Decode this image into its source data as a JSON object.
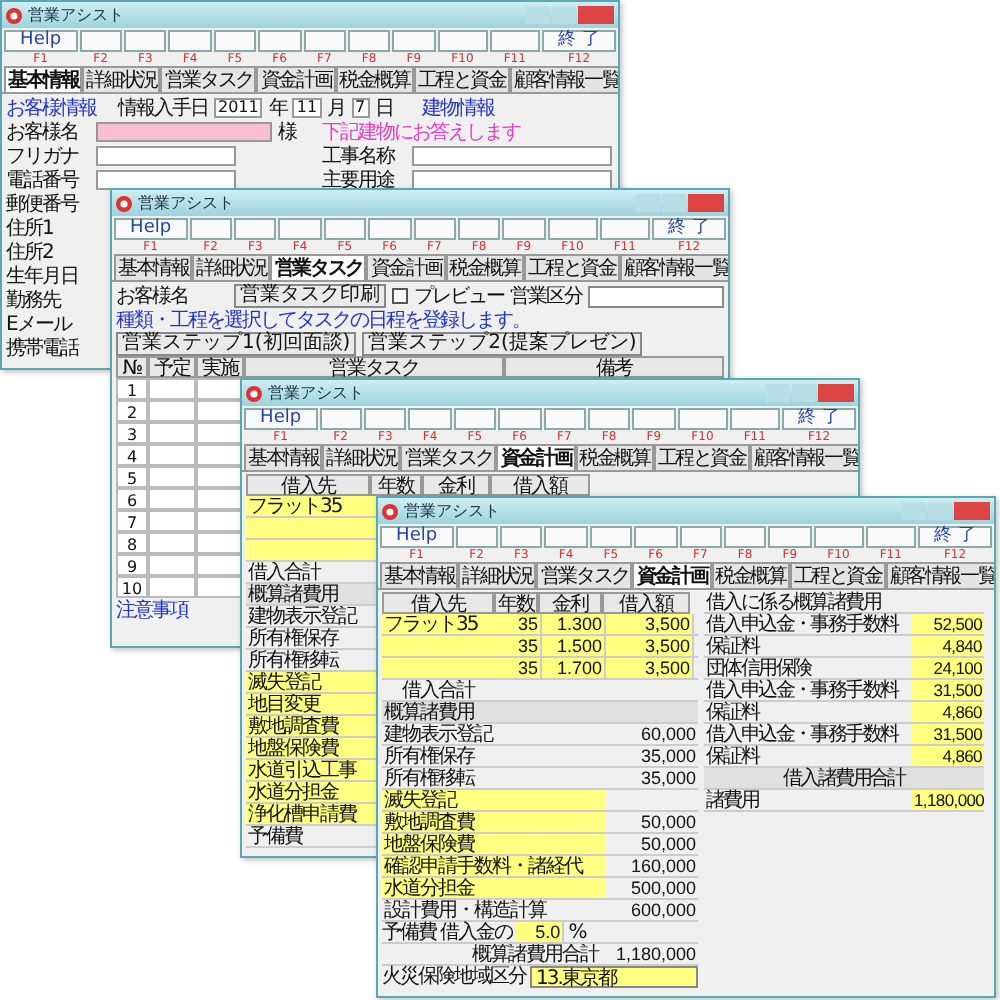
{
  "windows": [
    {
      "kind": "customer",
      "title": "営業アシスト",
      "toolbar": [
        {
          "key": "F1",
          "label": "Help"
        },
        {
          "key": "F2"
        },
        {
          "key": "F3"
        },
        {
          "key": "F4"
        },
        {
          "key": "F5"
        },
        {
          "key": "F6"
        },
        {
          "key": "F7"
        },
        {
          "key": "F8"
        },
        {
          "key": "F9"
        },
        {
          "key": "F10"
        },
        {
          "key": "F11"
        },
        {
          "key": "F12",
          "label": "終 了"
        }
      ],
      "tabs": [
        {
          "label": "基本情報",
          "selected": true
        },
        {
          "label": "詳細状況",
          "selected": false
        },
        {
          "label": "営業タスク",
          "selected": false
        },
        {
          "label": "資金計画",
          "selected": false
        },
        {
          "label": "税金概算",
          "selected": false
        },
        {
          "label": "工程と資金",
          "selected": false
        },
        {
          "label": "顧客情報一覧",
          "selected": false
        }
      ],
      "section": "お客様情報",
      "date_label": "情報入手日",
      "year": "2011",
      "year_unit": "年",
      "month": "11",
      "month_unit": "月",
      "day": "7",
      "day_unit": "日",
      "building": "建物情報",
      "fields": [
        {
          "kind": "name",
          "label": "お客様名",
          "suffix": "様"
        },
        {
          "kind": "field",
          "label": "フリガナ"
        },
        {
          "kind": "field",
          "label": "電話番号"
        },
        {
          "kind": "label",
          "label": "郵便番号"
        },
        {
          "kind": "label",
          "label": "住所1"
        },
        {
          "kind": "label",
          "label": "住所2"
        },
        {
          "kind": "label",
          "label": "生年月日"
        },
        {
          "kind": "label",
          "label": "勤務先"
        },
        {
          "kind": "label",
          "label": "Eメール"
        },
        {
          "kind": "label",
          "label": "携帯電話"
        }
      ],
      "right_fields": [
        {
          "kind": "note",
          "label": "下記建物にお答えします"
        },
        {
          "kind": "field",
          "label": "工事名称"
        },
        {
          "kind": "field",
          "label": "主要用途"
        }
      ]
    },
    {
      "kind": "tasks",
      "title": "営業アシスト",
      "toolbar": [
        {
          "key": "F1",
          "label": "Help"
        },
        {
          "key": "F2"
        },
        {
          "key": "F3"
        },
        {
          "key": "F4"
        },
        {
          "key": "F5"
        },
        {
          "key": "F6"
        },
        {
          "key": "F7"
        },
        {
          "key": "F8"
        },
        {
          "key": "F9"
        },
        {
          "key": "F10"
        },
        {
          "key": "F11"
        },
        {
          "key": "F12",
          "label": "終 了"
        }
      ],
      "tabs": [
        {
          "label": "基本情報",
          "selected": false
        },
        {
          "label": "詳細状況",
          "selected": false
        },
        {
          "label": "営業タスク",
          "selected": true
        },
        {
          "label": "資金計画",
          "selected": false
        },
        {
          "label": "税金概算",
          "selected": false
        },
        {
          "label": "工程と資金",
          "selected": false
        },
        {
          "label": "顧客情報一覧",
          "selected": false
        }
      ],
      "customer_label": "お客様名",
      "print_button": "営業タスク印刷",
      "preview": {
        "label": "プレビュー",
        "checked": false
      },
      "category_label": "営業区分",
      "note": "種類・工程を選択してタスクの日程を登録します。",
      "steps": [
        "営業ステップ1(初回面談)",
        "営業ステップ2(提案プレゼン)"
      ],
      "columns": [
        "№",
        "予定",
        "実施",
        "営業タスク",
        "備考"
      ],
      "rows": [
        {
          "no": "1"
        },
        {
          "no": "2"
        },
        {
          "no": "3"
        },
        {
          "no": "4"
        },
        {
          "no": "5"
        },
        {
          "no": "6"
        },
        {
          "no": "7"
        },
        {
          "no": "8"
        },
        {
          "no": "9"
        },
        {
          "no": "10"
        }
      ],
      "notes_title": "注意事項"
    },
    {
      "kind": "funds_back",
      "title": "営業アシスト",
      "toolbar": [
        {
          "key": "F1",
          "label": "Help"
        },
        {
          "key": "F2"
        },
        {
          "key": "F3"
        },
        {
          "key": "F4"
        },
        {
          "key": "F5"
        },
        {
          "key": "F6"
        },
        {
          "key": "F7"
        },
        {
          "key": "F8"
        },
        {
          "key": "F9"
        },
        {
          "key": "F10"
        },
        {
          "key": "F11"
        },
        {
          "key": "F12",
          "label": "終 了"
        }
      ],
      "tabs": [
        {
          "label": "基本情報",
          "selected": false
        },
        {
          "label": "詳細状況",
          "selected": false
        },
        {
          "label": "営業タスク",
          "selected": false
        },
        {
          "label": "資金計画",
          "selected": true
        },
        {
          "label": "税金概算",
          "selected": false
        },
        {
          "label": "工程と資金",
          "selected": false
        },
        {
          "label": "顧客情報一覧",
          "selected": false
        }
      ],
      "columns": [
        "借入先",
        "年数",
        "金利",
        "借入額"
      ],
      "rows": [
        {
          "kind": "loan",
          "label": "フラット35"
        },
        {
          "kind": "loan"
        },
        {
          "kind": "loan"
        },
        {
          "kind": "total",
          "label": "借入合計"
        },
        {
          "kind": "section",
          "label": "概算諸費用"
        },
        {
          "kind": "cost",
          "label": "建物表示登記"
        },
        {
          "kind": "cost",
          "label": "所有権保存"
        },
        {
          "kind": "cost",
          "label": "所有権移転"
        },
        {
          "kind": "yellow",
          "label": "滅失登記"
        },
        {
          "kind": "yellow",
          "label": "地目変更"
        },
        {
          "kind": "yellow",
          "label": "敷地調査費"
        },
        {
          "kind": "yellow",
          "label": "地盤保険費"
        },
        {
          "kind": "yellow",
          "label": "水道引込工事"
        },
        {
          "kind": "yellow",
          "label": "水道分担金"
        },
        {
          "kind": "yellow",
          "label": "浄化槽申請費"
        },
        {
          "kind": "cost",
          "label": "予備費"
        }
      ]
    },
    {
      "kind": "funds",
      "title": "営業アシスト",
      "toolbar": [
        {
          "key": "F1",
          "label": "Help"
        },
        {
          "key": "F2"
        },
        {
          "key": "F3"
        },
        {
          "key": "F4"
        },
        {
          "key": "F5"
        },
        {
          "key": "F6"
        },
        {
          "key": "F7"
        },
        {
          "key": "F8"
        },
        {
          "key": "F9"
        },
        {
          "key": "F10"
        },
        {
          "key": "F11"
        },
        {
          "key": "F12",
          "label": "終 了"
        }
      ],
      "tabs": [
        {
          "label": "基本情報",
          "selected": false
        },
        {
          "label": "詳細状況",
          "selected": false
        },
        {
          "label": "営業タスク",
          "selected": false
        },
        {
          "label": "資金計画",
          "selected": true
        },
        {
          "label": "税金概算",
          "selected": false
        },
        {
          "label": "工程と資金",
          "selected": false
        },
        {
          "label": "顧客情報一覧",
          "selected": false
        }
      ],
      "columns": [
        "借入先",
        "年数",
        "金利",
        "借入額"
      ],
      "rows": [
        {
          "kind": "loan",
          "label": "フラット35",
          "years": "35",
          "rate": "1.300",
          "amount": "3,500"
        },
        {
          "kind": "loan",
          "years": "35",
          "rate": "1.500",
          "amount": "3,500"
        },
        {
          "kind": "loan",
          "years": "35",
          "rate": "1.700",
          "amount": "3,500"
        },
        {
          "kind": "total",
          "label": "借入合計"
        },
        {
          "kind": "section",
          "label": "概算諸費用"
        },
        {
          "kind": "cost",
          "label": "建物表示登記",
          "value": "60,000"
        },
        {
          "kind": "cost",
          "label": "所有権保存",
          "value": "35,000"
        },
        {
          "kind": "cost",
          "label": "所有権移転",
          "value": "35,000"
        },
        {
          "kind": "yellow",
          "label": "滅失登記"
        },
        {
          "kind": "yellow",
          "label": "敷地調査費",
          "value": "50,000"
        },
        {
          "kind": "yellow",
          "label": "地盤保険費",
          "value": "50,000"
        },
        {
          "kind": "yellow",
          "label": "確認申請手数料・諸経代",
          "value": "160,000"
        },
        {
          "kind": "yellow",
          "label": "水道分担金",
          "value": "500,000"
        },
        {
          "kind": "cost",
          "label": "設計費用・構造計算",
          "value": "600,000"
        },
        {
          "kind": "reserve",
          "label": "予備費 借入金の",
          "percent": "5.0",
          "unit": "%"
        },
        {
          "kind": "sum",
          "label": "概算諸費用合計",
          "value": "1,180,000"
        },
        {
          "kind": "select",
          "label": "火災保険地域区分",
          "region": "13.東京都"
        }
      ],
      "right_rows": [
        {
          "kind": "section",
          "label": "借入に係る概算諸費用"
        },
        {
          "kind": "cost",
          "label": "借入申込金・事務手数料",
          "value": "52,500"
        },
        {
          "kind": "cost",
          "label": "保証料",
          "value": "4,840"
        },
        {
          "kind": "cost",
          "label": "団体信用保険",
          "value": "24,100"
        },
        {
          "kind": "cost",
          "label": "借入申込金・事務手数料",
          "value": "31,500"
        },
        {
          "kind": "cost",
          "label": "保証料",
          "value": "4,860"
        },
        {
          "kind": "cost",
          "label": "借入申込金・事務手数料",
          "value": "31,500"
        },
        {
          "kind": "cost",
          "label": "保証料",
          "value": "4,860"
        },
        {
          "kind": "total",
          "label": "借入諸費用合計"
        },
        {
          "kind": "cost",
          "label": "諸費用",
          "value": "1,180,000"
        }
      ]
    }
  ]
}
